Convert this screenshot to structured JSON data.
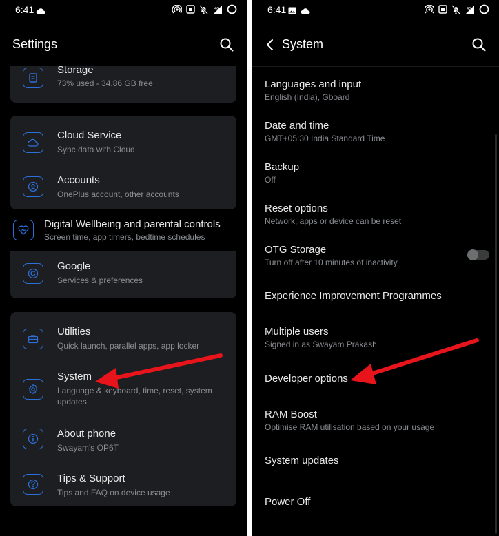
{
  "left": {
    "status": {
      "time": "6:41"
    },
    "header": {
      "title": "Settings"
    },
    "cards": [
      {
        "items": [
          {
            "icon": "storage-icon",
            "title": "Storage",
            "subtitle": "73% used - 34.86 GB free"
          }
        ]
      },
      {
        "items": [
          {
            "icon": "cloud-icon",
            "title": "Cloud Service",
            "subtitle": "Sync data with Cloud"
          },
          {
            "icon": "account-icon",
            "title": "Accounts",
            "subtitle": "OnePlus account, other accounts"
          }
        ]
      },
      {
        "items": [
          {
            "icon": "heart-icon",
            "title": "Digital Wellbeing and parental controls",
            "subtitle": "Screen time, app timers, bedtime schedules"
          }
        ]
      },
      {
        "items": [
          {
            "icon": "google-icon",
            "title": "Google",
            "subtitle": "Services & preferences"
          }
        ]
      },
      {
        "items": [
          {
            "icon": "toolbox-icon",
            "title": "Utilities",
            "subtitle": "Quick launch, parallel apps, app locker"
          },
          {
            "icon": "gear-icon",
            "title": "System",
            "subtitle": "Language & keyboard, time, reset, system updates"
          },
          {
            "icon": "info-icon",
            "title": "About phone",
            "subtitle": "Swayam's OP6T"
          },
          {
            "icon": "help-icon",
            "title": "Tips & Support",
            "subtitle": "Tips and FAQ on device usage"
          }
        ]
      }
    ]
  },
  "right": {
    "status": {
      "time": "6:41"
    },
    "header": {
      "title": "System"
    },
    "items": [
      {
        "title": "Languages and input",
        "subtitle": "English (India), Gboard"
      },
      {
        "title": "Date and time",
        "subtitle": "GMT+05:30 India Standard Time"
      },
      {
        "title": "Backup",
        "subtitle": "Off"
      },
      {
        "title": "Reset options",
        "subtitle": "Network, apps or device can be reset"
      },
      {
        "title": "OTG Storage",
        "subtitle": "Turn off after 10 minutes of inactivity",
        "toggle": false
      },
      {
        "title": "Experience Improvement Programmes",
        "subtitle": ""
      },
      {
        "title": "Multiple users",
        "subtitle": "Signed in as Swayam Prakash"
      },
      {
        "title": "Developer options",
        "subtitle": ""
      },
      {
        "title": "RAM Boost",
        "subtitle": "Optimise RAM utilisation based on your usage"
      },
      {
        "title": "System updates",
        "subtitle": ""
      },
      {
        "title": "Power Off",
        "subtitle": ""
      }
    ]
  },
  "colors": {
    "accent": "#2d6fd6",
    "card": "#1c1e21",
    "annotation_arrow": "#e8141b"
  }
}
